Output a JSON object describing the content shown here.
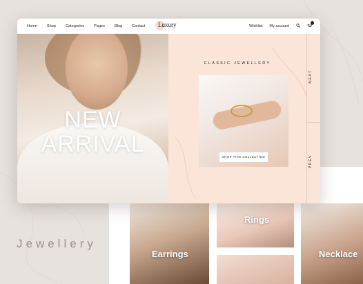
{
  "caption": "Jewellery",
  "nav": {
    "menu": [
      "Home",
      "Shop",
      "Categories",
      "Pages",
      "Blog",
      "Contact"
    ],
    "logo": "Luxury",
    "wishlist": "Wishlist",
    "account": "My account",
    "cart_count": "0"
  },
  "hero": {
    "headline_line1": "NEW",
    "headline_line2": "ARRIVAL",
    "collection_title": "CLASSIC JEWELLERY",
    "shop_button": "SHOP THIS COLLECTION",
    "next_label": "NEXT",
    "prev_label": "PREV"
  },
  "categories": {
    "earrings": "Earrings",
    "rings": "Rings",
    "necklace": "Necklace"
  },
  "colors": {
    "background": "#e7e2de",
    "hero_panel": "#fbe5d8",
    "accent_gold": "#c99a4a"
  },
  "icons": [
    "search-icon",
    "cart-icon"
  ]
}
